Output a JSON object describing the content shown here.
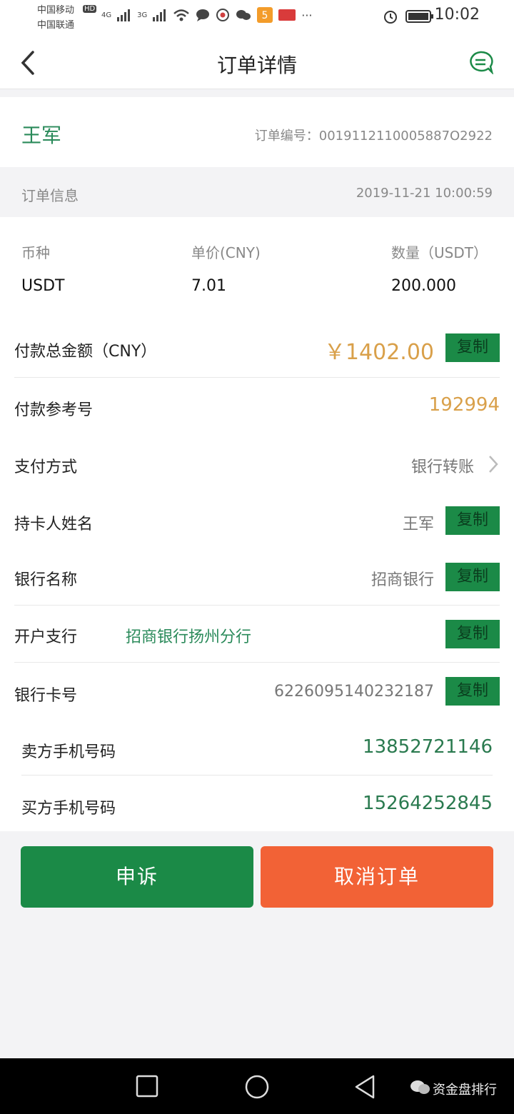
{
  "status_bar": {
    "carrier1": "中国移动",
    "carrier2": "中国联通",
    "hd": "HD",
    "net1": "4G",
    "net2": "3G",
    "more": "···",
    "time": "10:02"
  },
  "header": {
    "title": "订单详情"
  },
  "seller": {
    "name": "王军",
    "order_no": "订单编号：0019112110005887O2922"
  },
  "order_info": {
    "label": "订单信息",
    "datetime": "2019-11-21 10:00:59"
  },
  "columns": {
    "headers": [
      "币种",
      "单价(CNY)",
      "数量（USDT）"
    ],
    "values": [
      "USDT",
      "7.01",
      "200.000"
    ]
  },
  "rows": {
    "total_label": "付款总金额（CNY）",
    "total_value": "￥1402.00",
    "ref_label": "付款参考号",
    "ref_value": "192994",
    "method_label": "支付方式",
    "method_value": "银行转账",
    "holder_label": "持卡人姓名",
    "holder_value": "王军",
    "bank_label": "银行名称",
    "bank_value": "招商银行",
    "branch_label": "开户支行",
    "branch_value": "招商银行扬州分行",
    "card_label": "银行卡号",
    "card_value": "6226095140232187",
    "seller_phone_label": "卖方手机号码",
    "seller_phone_value": "13852721146",
    "buyer_phone_label": "买方手机号码",
    "buyer_phone_value": "15264252845"
  },
  "copy_label": "复制",
  "actions": {
    "appeal": "申诉",
    "cancel": "取消订单"
  },
  "watermark": "资金盘排行",
  "colors": {
    "green": "#1b8a47",
    "orange": "#d9a04a",
    "red": "#f26236",
    "teal": "#2a8a5a"
  }
}
